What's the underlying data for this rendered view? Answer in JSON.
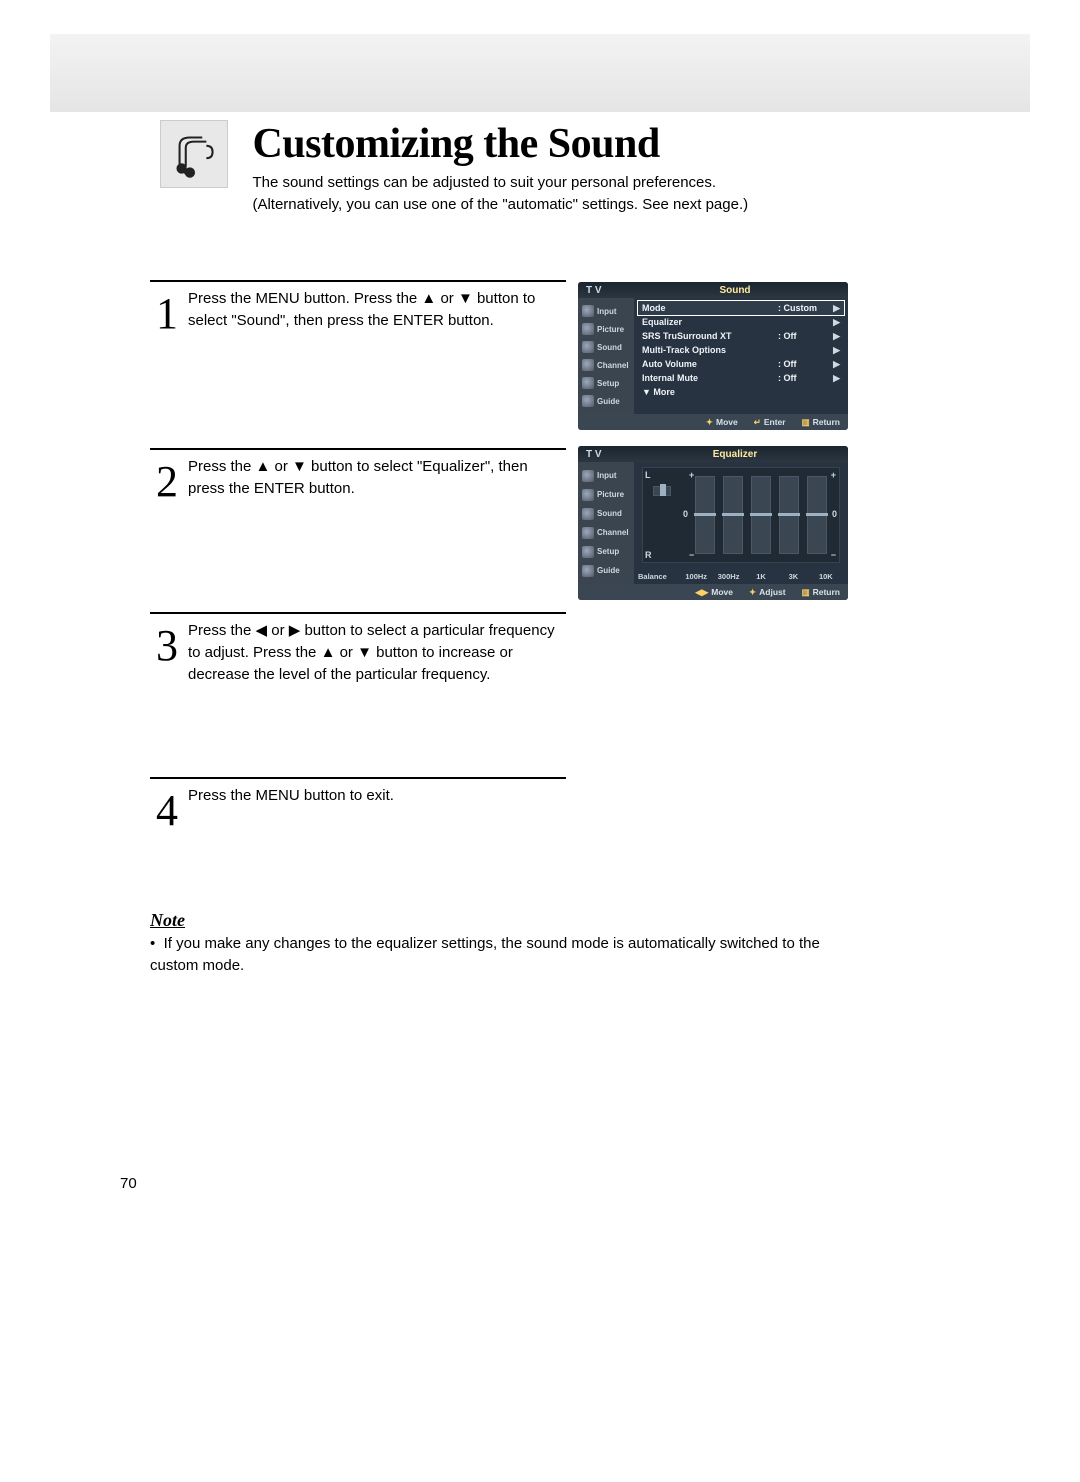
{
  "header": {
    "title": "Customizing the Sound",
    "subtitle_line1": "The sound settings can be adjusted to suit your personal preferences.",
    "subtitle_line2": "(Alternatively, you can use one of the \"automatic\" settings. See next page.)"
  },
  "steps": [
    {
      "num": "1",
      "body": "Press the MENU button. Press the ▲ or ▼ button to select \"Sound\", then press the ENTER button."
    },
    {
      "num": "2",
      "body": "Press the ▲ or ▼ button to select \"Equalizer\", then press the ENTER button."
    },
    {
      "num": "3",
      "body": "Press the ◀ or ▶ button to select a particular frequency to adjust. Press the ▲ or ▼ button to increase or decrease the level of the particular frequency."
    },
    {
      "num": "4",
      "body": "Press the MENU button to exit."
    }
  ],
  "note": {
    "heading": "Note",
    "bullet": "•",
    "body": "If you make any changes to the equalizer settings, the sound mode is automatically switched to the custom mode."
  },
  "osd_common": {
    "tv": "T V",
    "side_items": [
      "Input",
      "Picture",
      "Sound",
      "Channel",
      "Setup",
      "Guide"
    ]
  },
  "sound_menu": {
    "title": "Sound",
    "rows": [
      {
        "label": "Mode",
        "value": ": Custom",
        "selected": true
      },
      {
        "label": "Equalizer",
        "value": "",
        "selected": false
      },
      {
        "label": "SRS TruSurround XT",
        "value": ": Off",
        "selected": false
      },
      {
        "label": "Multi-Track Options",
        "value": "",
        "selected": false
      },
      {
        "label": "Auto Volume",
        "value": ": Off",
        "selected": false
      },
      {
        "label": "Internal Mute",
        "value": ": Off",
        "selected": false
      },
      {
        "label": "▼ More",
        "value": "",
        "selected": false
      }
    ],
    "footer": {
      "a": "Move",
      "a_sym": "✦",
      "b": "Enter",
      "b_sym": "↵",
      "c": "Return",
      "c_sym": "▥"
    }
  },
  "equalizer_menu": {
    "title": "Equalizer",
    "L": "L",
    "R": "R",
    "plus": "+",
    "minus": "−",
    "zero": "0",
    "balance_label": "Balance",
    "freqs": [
      "100Hz",
      "300Hz",
      "1K",
      "3K",
      "10K"
    ],
    "footer": {
      "a": "Move",
      "a_sym": "◀▶",
      "b": "Adjust",
      "b_sym": "✦",
      "c": "Return",
      "c_sym": "▥"
    }
  },
  "page_number": "70",
  "chart_data": {
    "type": "bar",
    "title": "Equalizer",
    "categories": [
      "Balance",
      "100Hz",
      "300Hz",
      "1K",
      "3K",
      "10K"
    ],
    "values": [
      0,
      0,
      0,
      0,
      0,
      0
    ],
    "ylim": [
      -10,
      10
    ],
    "xlabel": "",
    "ylabel": ""
  }
}
